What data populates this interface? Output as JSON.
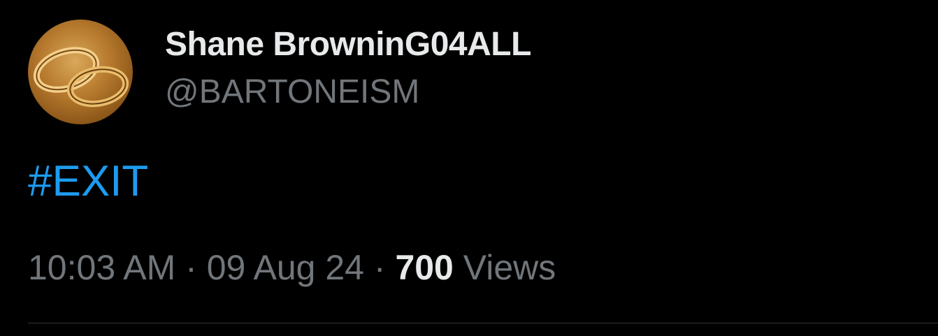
{
  "author": {
    "display_name": "Shane BrowninG04ALL",
    "handle": "@BARTONEISM",
    "avatar_icon": "wedding-rings-icon"
  },
  "tweet": {
    "text": "#EXIT"
  },
  "meta": {
    "time": "10:03 AM",
    "separator": "·",
    "date": "09 Aug 24",
    "views_count": "700",
    "views_label": "Views"
  },
  "colors": {
    "background": "#000000",
    "primary_text": "#e7e9ea",
    "secondary_text": "#71767b",
    "link": "#1d9bf0",
    "divider": "#2f3336"
  }
}
